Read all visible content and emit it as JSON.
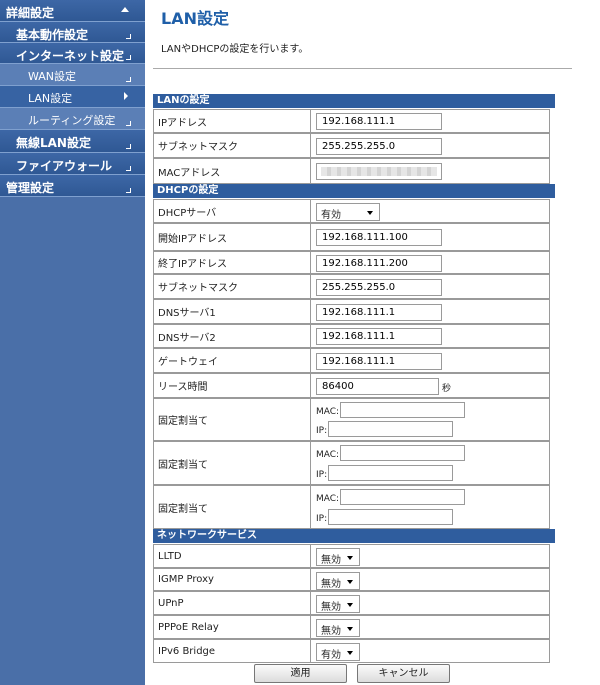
{
  "sidebar": {
    "items": [
      {
        "label": "詳細設定"
      },
      {
        "label": "基本動作設定"
      },
      {
        "label": "インターネット設定"
      },
      {
        "label": "WAN設定"
      },
      {
        "label": "LAN設定"
      },
      {
        "label": "ルーティング設定"
      },
      {
        "label": "無線LAN設定"
      },
      {
        "label": "ファイアウォール"
      },
      {
        "label": "管理設定"
      }
    ]
  },
  "page": {
    "title": "LAN設定",
    "description": "LANやDHCPの設定を行います。"
  },
  "lan": {
    "header": "LANの設定",
    "ip_label": "IPアドレス",
    "ip_value": "192.168.111.1",
    "subnet_label": "サブネットマスク",
    "subnet_value": "255.255.255.0",
    "mac_label": "MACアドレス"
  },
  "dhcp": {
    "header": "DHCPの設定",
    "server_label": "DHCPサーバ",
    "server_value": "有効",
    "start_label": "開始IPアドレス",
    "start_value": "192.168.111.100",
    "end_label": "終了IPアドレス",
    "end_value": "192.168.111.200",
    "subnet_label": "サブネットマスク",
    "subnet_value": "255.255.255.0",
    "dns1_label": "DNSサーバ1",
    "dns1_value": "192.168.111.1",
    "dns2_label": "DNSサーバ2",
    "dns2_value": "192.168.111.1",
    "gateway_label": "ゲートウェイ",
    "gateway_value": "192.168.111.1",
    "lease_label": "リース時間",
    "lease_value": "86400",
    "lease_unit": "秒",
    "static_label": "固定割当て",
    "mac_prefix": "MAC:",
    "ip_prefix": "IP:"
  },
  "network": {
    "header": "ネットワークサービス",
    "lltd_label": "LLTD",
    "lltd_value": "無効",
    "igmp_label": "IGMP Proxy",
    "igmp_value": "無効",
    "upnp_label": "UPnP",
    "upnp_value": "無効",
    "pppoe_label": "PPPoE Relay",
    "pppoe_value": "無効",
    "ipv6_label": "IPv6 Bridge",
    "ipv6_value": "有効"
  },
  "buttons": {
    "apply": "適用",
    "cancel": "キャンセル"
  }
}
